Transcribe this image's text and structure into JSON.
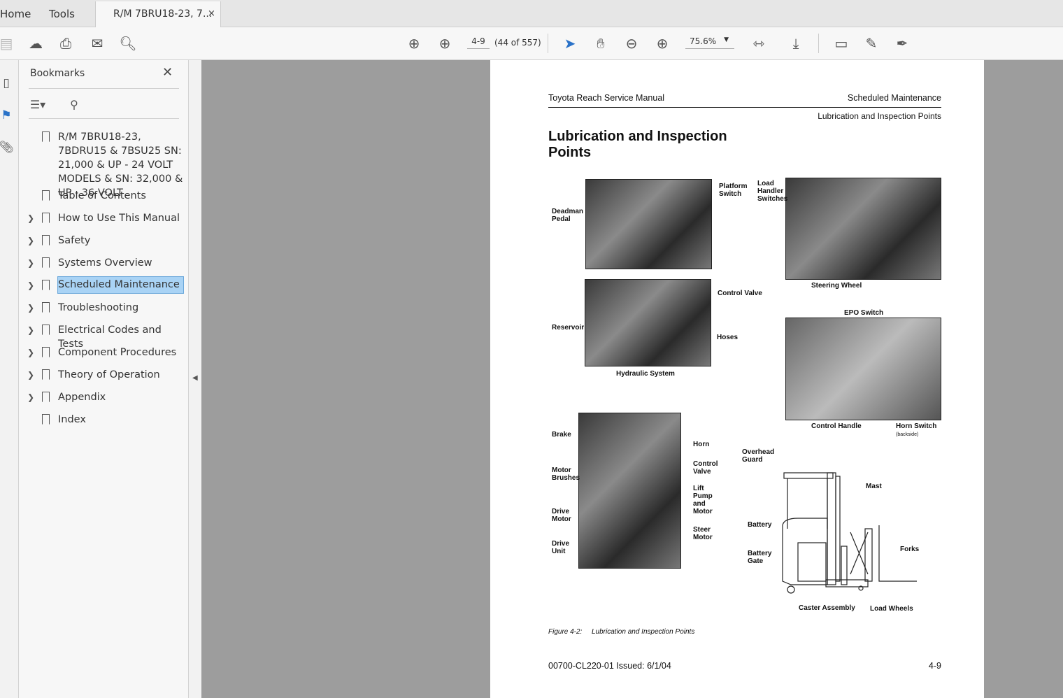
{
  "tabs": {
    "home": "Home",
    "tools": "Tools",
    "document": "R/M 7BRU18-23, 7...",
    "close": "×"
  },
  "toolbar": {
    "page_input": "4-9",
    "page_count": "(44 of 557)",
    "zoom": "75.6%"
  },
  "bookmarks": {
    "title": "Bookmarks",
    "items": [
      {
        "label": "R/M 7BRU18-23, 7BDRU15 & 7BSU25 SN: 21,000 & UP - 24 VOLT MODELS & SN: 32,000 & UP - 36 VOLT",
        "expandable": false
      },
      {
        "label": "Table of Contents",
        "expandable": false
      },
      {
        "label": "How to Use This Manual",
        "expandable": true
      },
      {
        "label": "Safety",
        "expandable": true
      },
      {
        "label": "Systems Overview",
        "expandable": true
      },
      {
        "label": "Scheduled Maintenance",
        "expandable": true,
        "selected": true
      },
      {
        "label": "Troubleshooting",
        "expandable": true
      },
      {
        "label": "Electrical Codes and Tests",
        "expandable": true
      },
      {
        "label": "Component Procedures",
        "expandable": true
      },
      {
        "label": "Theory of Operation",
        "expandable": true
      },
      {
        "label": "Appendix",
        "expandable": true
      },
      {
        "label": "Index",
        "expandable": false
      }
    ]
  },
  "page": {
    "header_left": "Toyota Reach Service Manual",
    "header_right": "Scheduled Maintenance",
    "subheader": "Lubrication and Inspection Points",
    "title_line1": "Lubrication and Inspection",
    "title_line2": "Points",
    "labels": {
      "platform_switch": "Platform Switch",
      "deadman_pedal": "Deadman Pedal",
      "load_handler_switches": "Load Handler Switches",
      "steering_wheel": "Steering Wheel",
      "control_valve": "Control Valve",
      "reservoir": "Reservoir",
      "hoses": "Hoses",
      "hydraulic_system": "Hydraulic System",
      "epo_switch": "EPO Switch",
      "control_handle": "Control Handle",
      "horn_switch": "Horn Switch",
      "backside": "(backside)",
      "brake": "Brake",
      "horn": "Horn",
      "control_valve2": "Control Valve",
      "motor_brushes": "Motor Brushes",
      "lift_pump": "Lift Pump and Motor",
      "drive_motor": "Drive Motor",
      "steer_motor": "Steer Motor",
      "drive_unit": "Drive Unit",
      "overhead_guard": "Overhead Guard",
      "mast": "Mast",
      "battery": "Battery",
      "battery_gate": "Battery Gate",
      "forks": "Forks",
      "caster_assembly": "Caster Assembly",
      "load_wheels": "Load Wheels"
    },
    "figure_number": "Figure 4-2:",
    "figure_caption": "Lubrication and Inspection Points",
    "footer_left": "00700-CL220-01 Issued: 6/1/04",
    "footer_right": "4-9"
  }
}
